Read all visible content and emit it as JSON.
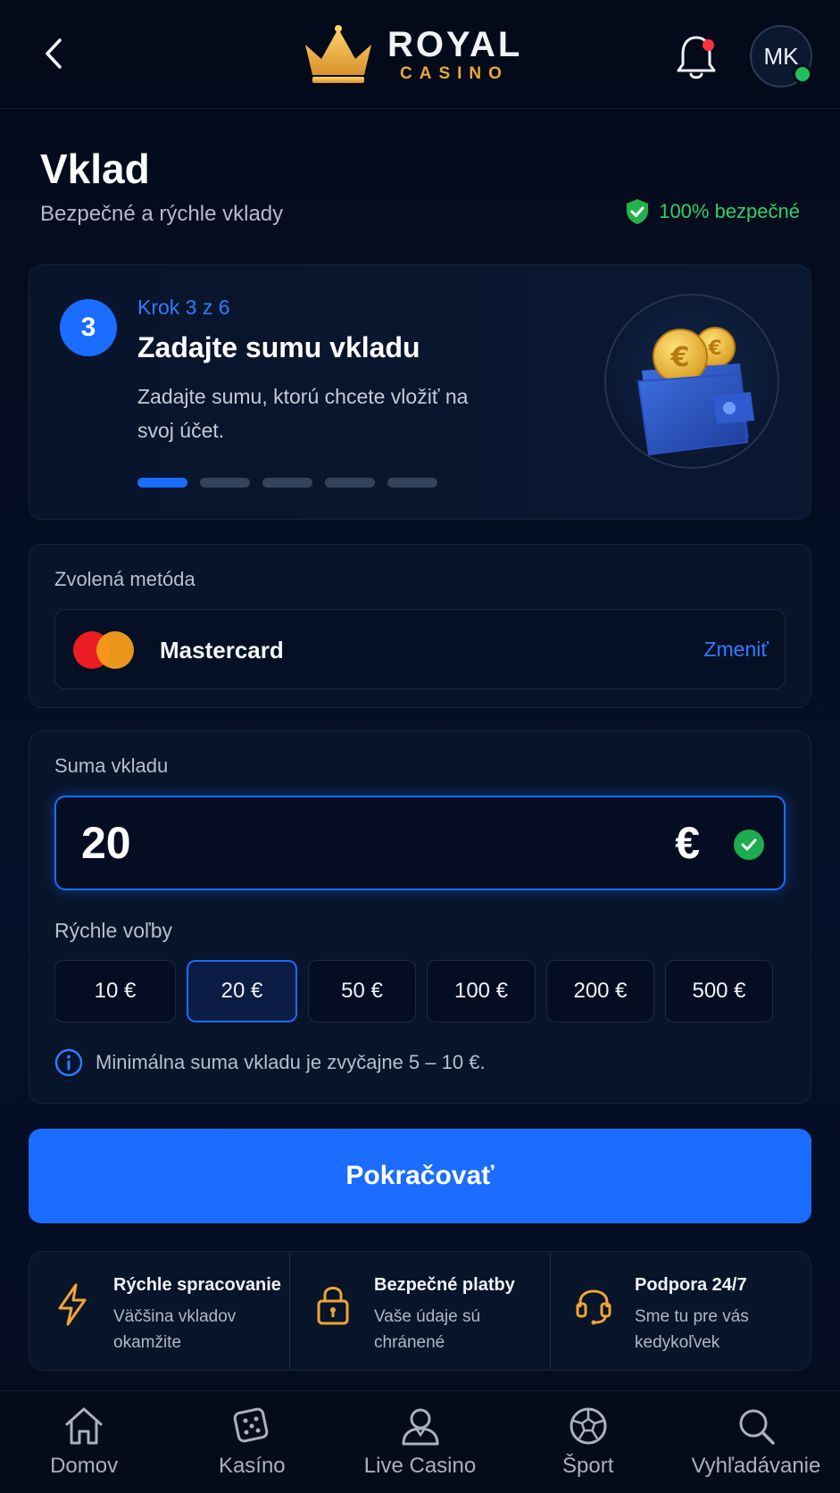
{
  "header": {
    "logo_top": "ROYAL",
    "logo_bottom": "CASINO",
    "avatar_initials": "MK",
    "back_icon": "chevron-left-icon",
    "bell_icon": "bell-icon"
  },
  "page": {
    "title": "Vklad",
    "subtitle": "Bezpečné a rýchle vklady",
    "secure_badge": "100% bezpečné"
  },
  "step": {
    "number": "3",
    "label": "Krok 3 z 6",
    "title": "Zadajte sumu vkladu",
    "description": "Zadajte sumu, ktorú chcete vložiť na svoj účet.",
    "progress_total": 5,
    "progress_active": 1
  },
  "method": {
    "label": "Zvolená metóda",
    "name": "Mastercard",
    "change_label": "Zmeniť"
  },
  "amount": {
    "label": "Suma vkladu",
    "value": "20",
    "currency": "€",
    "quick_label": "Rýchle voľby",
    "quick_options": [
      {
        "label": "10 €",
        "selected": false
      },
      {
        "label": "20 €",
        "selected": true
      },
      {
        "label": "50 €",
        "selected": false
      },
      {
        "label": "100 €",
        "selected": false
      },
      {
        "label": "200 €",
        "selected": false
      },
      {
        "label": "500 €",
        "selected": false
      }
    ],
    "info": "Minimálna suma vkladu je zvyčajne 5 – 10 €."
  },
  "continue_label": "Pokračovať",
  "features": [
    {
      "icon": "lightning-icon",
      "title": "Rýchle spracovanie",
      "desc": "Väčšina vkladov okamžite"
    },
    {
      "icon": "lock-icon",
      "title": "Bezpečné platby",
      "desc": "Vaše údaje sú chránené"
    },
    {
      "icon": "headset-icon",
      "title": "Podpora 24/7",
      "desc": "Sme tu pre vás kedykoľvek"
    }
  ],
  "nav": [
    {
      "icon": "home-icon",
      "label": "Domov"
    },
    {
      "icon": "dice-icon",
      "label": "Kasíno"
    },
    {
      "icon": "dealer-icon",
      "label": "Live Casino"
    },
    {
      "icon": "ball-icon",
      "label": "Šport"
    },
    {
      "icon": "search-icon",
      "label": "Vyhľadávanie"
    }
  ],
  "colors": {
    "accent": "#1a6dff",
    "gold": "#e9a83c",
    "success": "#2fd06a",
    "background": "#040c1c"
  }
}
